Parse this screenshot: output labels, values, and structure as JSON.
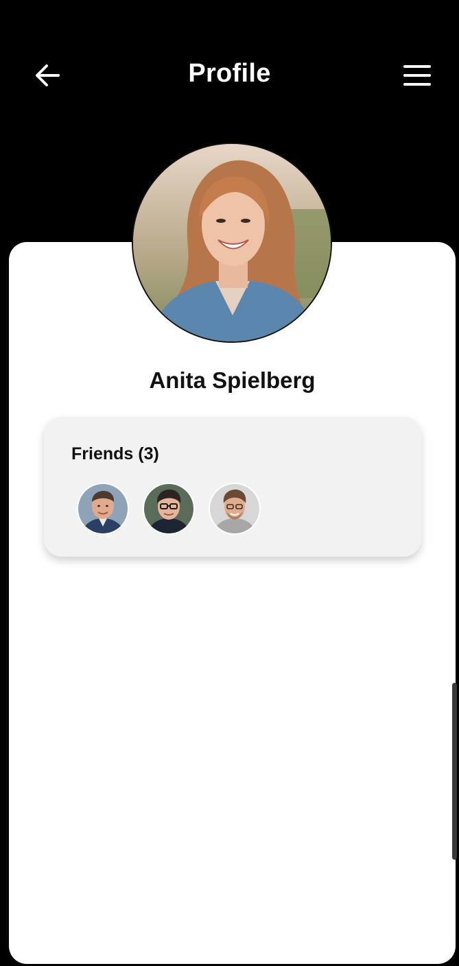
{
  "header": {
    "title": "Profile",
    "back_icon": "arrow-left-icon",
    "menu_icon": "hamburger-menu-icon"
  },
  "profile": {
    "name": "Anita Spielberg"
  },
  "friends": {
    "title": "Friends (3)",
    "items": [
      {
        "avatar": "friend-avatar-1"
      },
      {
        "avatar": "friend-avatar-2"
      },
      {
        "avatar": "friend-avatar-3"
      }
    ]
  },
  "colors": {
    "header_bg": "#000000",
    "card_bg": "#ffffff",
    "friends_card_bg": "#f2f2f2",
    "text": "#111111"
  }
}
